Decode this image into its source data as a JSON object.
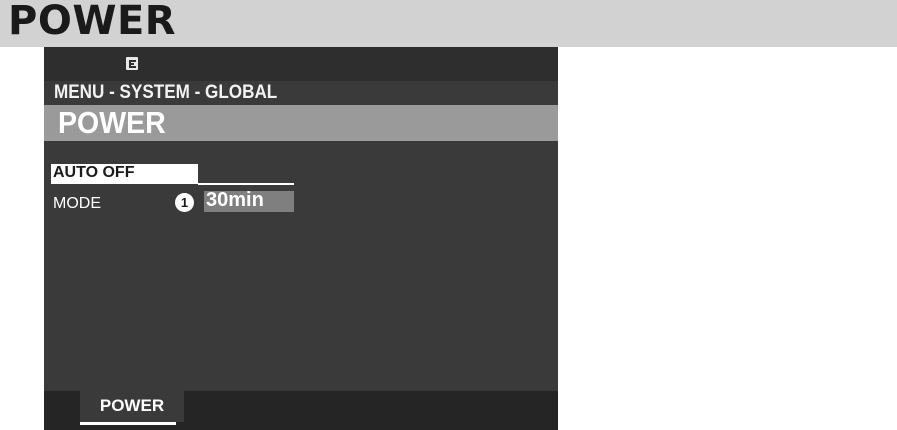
{
  "page": {
    "title": "POWER"
  },
  "screen": {
    "status_icon": "e-icon",
    "breadcrumb": "MENU - SYSTEM - GLOBAL",
    "header": "POWER",
    "params": [
      {
        "label": "AUTO OFF"
      },
      {
        "label": "MODE",
        "callout": "1",
        "value": "30min"
      }
    ],
    "tabs": [
      {
        "label": "POWER",
        "selected": true
      }
    ]
  }
}
